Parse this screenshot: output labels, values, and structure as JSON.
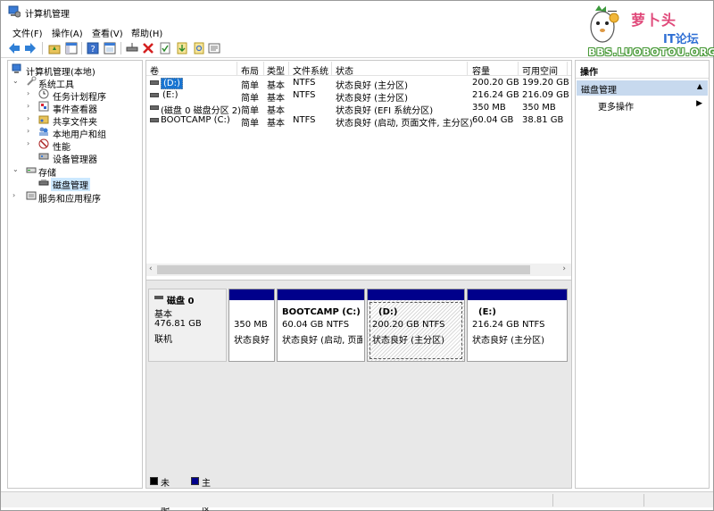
{
  "window": {
    "title": "计算机管理"
  },
  "logo": {
    "brand": "萝卜头",
    "sub": "IT论坛",
    "url": "BBS.LUOBOTOU.ORG"
  },
  "menu": [
    "文件(F)",
    "操作(A)",
    "查看(V)",
    "帮助(H)"
  ],
  "toolbar": [
    "back-arrow-icon",
    "forward-arrow-icon",
    "up-folder-icon",
    "show-hide-tree-icon",
    "help-icon",
    "console-icon",
    "connect-drive-icon",
    "delete-icon",
    "check-icon",
    "import-icon",
    "search-icon",
    "properties-icon"
  ],
  "tree": {
    "root": "计算机管理(本地)",
    "system_tools": "系统工具",
    "task_scheduler": "任务计划程序",
    "event_viewer": "事件查看器",
    "shared_folders": "共享文件夹",
    "local_users": "本地用户和组",
    "performance": "性能",
    "device_manager": "设备管理器",
    "storage": "存储",
    "disk_management": "磁盘管理",
    "services_apps": "服务和应用程序"
  },
  "volumes": {
    "headers": [
      "卷",
      "布局",
      "类型",
      "文件系统",
      "状态",
      "容量",
      "可用空间"
    ],
    "rows": [
      [
        "(D:)",
        "简单",
        "基本",
        "NTFS",
        "状态良好 (主分区)",
        "200.20 GB",
        "199.20 GB"
      ],
      [
        "(E:)",
        "简单",
        "基本",
        "NTFS",
        "状态良好 (主分区)",
        "216.24 GB",
        "216.09 GB"
      ],
      [
        "(磁盘 0 磁盘分区 2)",
        "简单",
        "基本",
        "",
        "状态良好 (EFI 系统分区)",
        "350 MB",
        "350 MB"
      ],
      [
        "BOOTCAMP (C:)",
        "简单",
        "基本",
        "NTFS",
        "状态良好 (启动, 页面文件, 主分区)",
        "60.04 GB",
        "38.81 GB"
      ]
    ]
  },
  "disk": {
    "name": "磁盘 0",
    "type": "基本",
    "size": "476.81 GB",
    "state": "联机",
    "partitions": [
      {
        "title": "",
        "size": "350 MB",
        "status": "状态良好"
      },
      {
        "title": "BOOTCAMP  (C:)",
        "size": "60.04 GB NTFS",
        "status": "状态良好 (启动, 页面"
      },
      {
        "title": "(D:)",
        "size": "200.20 GB NTFS",
        "status": "状态良好 (主分区)"
      },
      {
        "title": "(E:)",
        "size": "216.24 GB NTFS",
        "status": "状态良好 (主分区)"
      }
    ]
  },
  "legend": {
    "unallocated": "未分配",
    "primary": "主分区",
    "unallocated_color": "#000000",
    "primary_color": "#00008b"
  },
  "actions": {
    "header": "操作",
    "section": "磁盘管理",
    "more": "更多操作"
  }
}
